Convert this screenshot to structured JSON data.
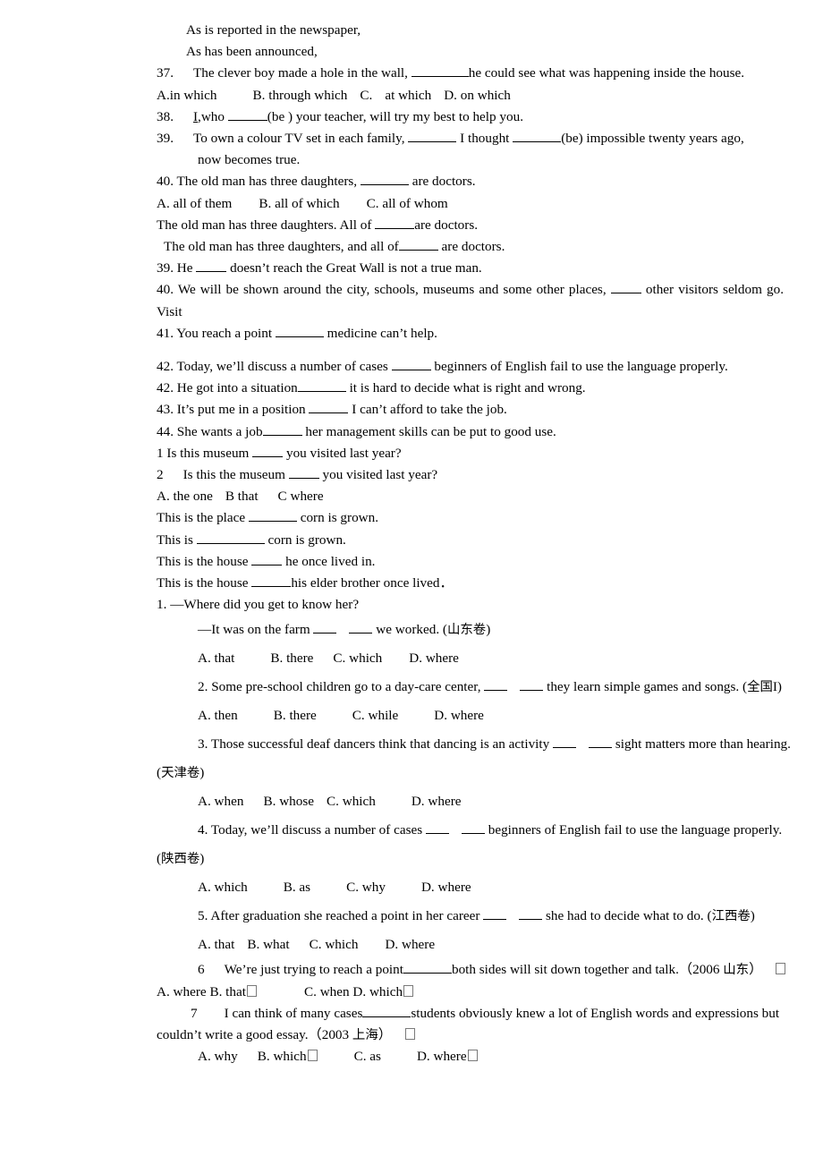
{
  "document": {
    "type": "grammar-worksheet",
    "language": "English with Chinese annotations",
    "page_background": "#ffffff",
    "text_color": "#000000"
  },
  "top_block": {
    "lines": [
      {
        "id": "as-is-reported",
        "text": "As is reported in the newspaper,"
      },
      {
        "id": "as-has-been",
        "text": "As has been announced,"
      },
      {
        "id": "q37-stem-num",
        "number": "37.",
        "text": "The clever boy made a hole in the wall, ",
        "text2": "he could see what was happening inside the house."
      },
      {
        "id": "q37-options",
        "text": "A.in which",
        "o2": "B. through which",
        "o3": "C.",
        "o3b": "at which",
        "o4": "D. on which"
      },
      {
        "id": "q38",
        "number": "38.",
        "pre": "I",
        "text": ",who ",
        "text2": "(be ) your teacher, will try my best to help you."
      },
      {
        "id": "q39a",
        "number": "39.",
        "text": "To own a colour TV set in each family, ",
        "text2": " I thought ",
        "text3": "(be) impossible twenty years ago,",
        "cont": "now becomes true."
      },
      {
        "id": "q40a",
        "text_a": "40. The old man has three daughters, ",
        "text_b": " are doctors."
      },
      {
        "id": "q40a-options",
        "o1": "A. all of them",
        "o2": "B. all of which",
        "o3": "C. all of whom"
      },
      {
        "id": "variant-1",
        "text_a": "The old man has three daughters. All of ",
        "text_b": "are doctors."
      },
      {
        "id": "variant-2",
        "text_a": "The old man has three daughters, and all of",
        "text_b": " are doctors."
      },
      {
        "id": "q39b",
        "text_a": "39. He ",
        "text_b": " doesn’t reach the Great Wall is not a true man."
      },
      {
        "id": "q40b",
        "text_a": "40. We will be shown around the city, schools, museums and some other places, ",
        "text_b": " other visitors seldom go.",
        "text_c": "Visit"
      },
      {
        "id": "q41",
        "text_a": "41. You reach a point ",
        "text_b": " medicine can’t help."
      },
      {
        "id": "q42a",
        "text_a": "42. Today, we’ll discuss a number of cases ",
        "text_b": " beginners of English fail to use the language properly."
      },
      {
        "id": "q42b",
        "text_a": "42. He got into a situation",
        "text_b": " it is hard to decide what is right and wrong."
      },
      {
        "id": "q43",
        "text_a": "43. It’s put me in a position ",
        "text_b": " I can’t afford to take the job."
      },
      {
        "id": "q44",
        "text_a": "44. She wants a job",
        "text_b": " her management skills can be put to good use."
      },
      {
        "id": "museum-1",
        "text_a": "1 Is this museum ",
        "text_b": " you visited last year?"
      },
      {
        "id": "museum-2",
        "text_a": "2",
        "text_b": "Is this the museum ",
        "text_c": " you visited last year?"
      },
      {
        "id": "museum-options",
        "o1": "A. the one",
        "o2": "B that",
        "o3": "C where"
      },
      {
        "id": "place-1",
        "text_a": "This is the place ",
        "text_b": " corn is grown."
      },
      {
        "id": "place-2",
        "text_a": "This is ",
        "text_b": " corn is grown."
      },
      {
        "id": "house-1",
        "text_a": "This is the house ",
        "text_b": " he once lived in."
      },
      {
        "id": "house-2",
        "text_a": "This is the house ",
        "text_b": "his elder brother once lived．"
      }
    ]
  },
  "bottom_block": {
    "items": [
      {
        "id": "ex1",
        "stem": "1. —Where did you get to know her?",
        "answer_line_a": "—It was on the farm ",
        "answer_line_b": " we worked. (",
        "answer_source": "山东卷",
        "answer_line_c": ")",
        "options": [
          "A. that",
          "B. there",
          "C. which",
          "D. where"
        ]
      },
      {
        "id": "ex2",
        "stem_a": "2. Some pre-school children go to a day-care center, ",
        "stem_b": " they learn simple games and songs. (",
        "stem_source": "全国",
        "stem_c": "I)",
        "options": [
          "A. then",
          "B. there",
          "C. while",
          "D. where"
        ]
      },
      {
        "id": "ex3",
        "stem_a": "3. Those successful deaf dancers think that dancing is an activity ",
        "stem_b": " sight matters more than hearing. (",
        "stem_source": "天津卷",
        "stem_c": ")",
        "options": [
          "A. when",
          "B. whose",
          "C. which",
          "D. where"
        ]
      },
      {
        "id": "ex4",
        "stem_a": "4. Today, we’ll discuss a number of cases ",
        "stem_b": " beginners of English fail to use the language properly. (",
        "stem_source": "陕西卷",
        "stem_c": ")",
        "options": [
          "A. which",
          "B. as",
          "C. why",
          "D. where"
        ]
      },
      {
        "id": "ex5",
        "stem_a": "5. After graduation she reached a point in her career ",
        "stem_b": " she had to decide what to do. (",
        "stem_source": "江西卷",
        "stem_c": ")",
        "options": [
          "A. that",
          "B. what",
          "C. which",
          "D. where"
        ]
      },
      {
        "id": "ex6",
        "number": "6",
        "stem_a": "We’re just trying to reach a point",
        "stem_b": "both sides will sit down together and talk.（2006 ",
        "stem_source": "山东",
        "stem_c": "）",
        "options_raw": {
          "o1": "A. where B. that",
          "o2": "C. when D. which"
        }
      },
      {
        "id": "ex7",
        "number": "7",
        "stem_a": "I can think of many cases",
        "stem_b": "students obviously knew a lot of English words and expressions but couldn’t write a good essay.（2003 ",
        "stem_source": "上海",
        "stem_c": "）",
        "options": [
          "A. why",
          "B. which",
          "C. as",
          "D. where"
        ]
      }
    ]
  }
}
